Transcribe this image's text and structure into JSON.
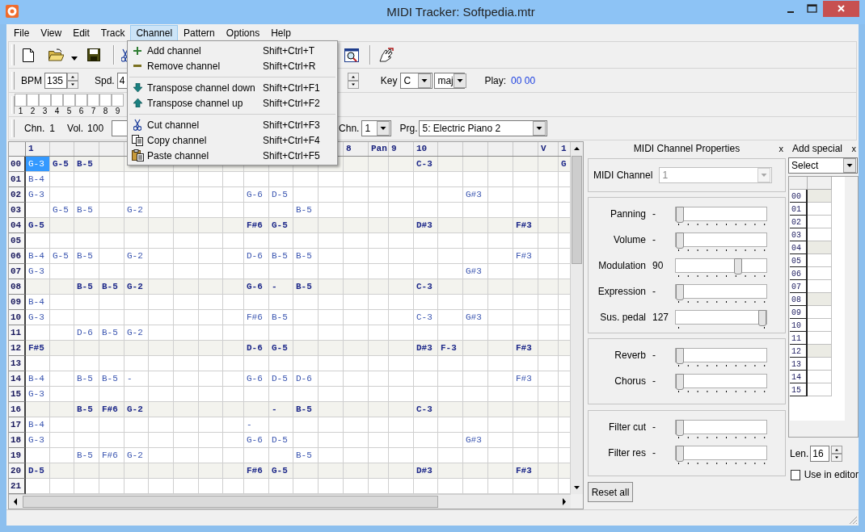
{
  "window": {
    "title": "MIDI Tracker: Softpedia.mtr"
  },
  "menu_bar": [
    {
      "label": "File",
      "selected": false
    },
    {
      "label": "View",
      "selected": false
    },
    {
      "label": "Edit",
      "selected": false
    },
    {
      "label": "Track",
      "selected": false
    },
    {
      "label": "Channel",
      "selected": true
    },
    {
      "label": "Pattern",
      "selected": false
    },
    {
      "label": "Options",
      "selected": false
    },
    {
      "label": "Help",
      "selected": false
    }
  ],
  "channel_menu": [
    {
      "kind": "item",
      "label": "Add channel",
      "shortcut": "Shift+Ctrl+T"
    },
    {
      "kind": "item",
      "label": "Remove channel",
      "shortcut": "Shift+Ctrl+R"
    },
    {
      "kind": "separator"
    },
    {
      "kind": "item",
      "label": "Transpose channel down",
      "shortcut": "Shift+Ctrl+F1"
    },
    {
      "kind": "item",
      "label": "Transpose channel up",
      "shortcut": "Shift+Ctrl+F2"
    },
    {
      "kind": "separator"
    },
    {
      "kind": "item",
      "label": "Cut channel",
      "shortcut": "Shift+Ctrl+F3"
    },
    {
      "kind": "item",
      "label": "Copy channel",
      "shortcut": "Shift+Ctrl+F4"
    },
    {
      "kind": "item",
      "label": "Paste channel",
      "shortcut": "Shift+Ctrl+F5"
    }
  ],
  "tempo_bar": {
    "bpm_label": "BPM",
    "bpm": "135",
    "speed_label": "Spd.",
    "speed": "4",
    "key_label": "Key",
    "key": "C",
    "scale": "maj",
    "play_label": "Play:",
    "play_position": "00 00"
  },
  "mute_bar": [
    {
      "label": "1",
      "checked": false
    },
    {
      "label": "2",
      "checked": false
    },
    {
      "label": "3",
      "checked": false
    },
    {
      "label": "4",
      "checked": false
    },
    {
      "label": "5",
      "checked": false
    },
    {
      "label": "6",
      "checked": false
    },
    {
      "label": "7",
      "checked": false
    },
    {
      "label": "8",
      "checked": false
    },
    {
      "label": "9",
      "checked": false
    }
  ],
  "channel_bar": {
    "channel_label": "Chn.",
    "channel": "1",
    "volume_label": "Vol.",
    "volume": "100",
    "midi_channel_label": "Chn.",
    "midi_channel": "1",
    "program_label": "Prg.",
    "program": "5: Electric Piano 2"
  },
  "pattern": {
    "headers": {
      "col_0": "1",
      "col_13": "8",
      "col_14": "Pan",
      "col_15": "9",
      "col_16": "10",
      "col_21": "V",
      "col_22": "1"
    },
    "rows": [
      {
        "label": "00",
        "accent": true,
        "cells": {
          "col_0": {
            "text": "G-3",
            "selected": true
          },
          "col_1": {
            "text": "G-5",
            "selected": false
          },
          "col_2": {
            "text": "B-5",
            "selected": false
          },
          "col_16": {
            "text": "C-3",
            "selected": false
          },
          "col_22": {
            "text": "G",
            "selected": false
          }
        }
      },
      {
        "label": "01",
        "accent": false,
        "cells": {
          "col_0": {
            "text": "B-4",
            "selected": false
          }
        }
      },
      {
        "label": "02",
        "accent": false,
        "cells": {
          "col_0": {
            "text": "G-3",
            "selected": false
          },
          "col_9": {
            "text": "G-6",
            "selected": false
          },
          "col_10": {
            "text": "D-5",
            "selected": false
          },
          "col_18": {
            "text": "G#3",
            "selected": false
          }
        }
      },
      {
        "label": "03",
        "accent": false,
        "cells": {
          "col_1": {
            "text": "G-5",
            "selected": false
          },
          "col_2": {
            "text": "B-5",
            "selected": false
          },
          "col_4": {
            "text": "G-2",
            "selected": false
          },
          "col_11": {
            "text": "B-5",
            "selected": false
          }
        }
      },
      {
        "label": "04",
        "accent": true,
        "cells": {
          "col_0": {
            "text": "G-5",
            "selected": false
          },
          "col_9": {
            "text": "F#6",
            "selected": false
          },
          "col_10": {
            "text": "G-5",
            "selected": false
          },
          "col_16": {
            "text": "D#3",
            "selected": false
          },
          "col_20": {
            "text": "F#3",
            "selected": false
          }
        }
      },
      {
        "label": "05",
        "accent": false
      },
      {
        "label": "06",
        "accent": false,
        "cells": {
          "col_0": {
            "text": "B-4",
            "selected": false
          },
          "col_1": {
            "text": "G-5",
            "selected": false
          },
          "col_2": {
            "text": "B-5",
            "selected": false
          },
          "col_4": {
            "text": "G-2",
            "selected": false
          },
          "col_9": {
            "text": "D-6",
            "selected": false
          },
          "col_10": {
            "text": "B-5",
            "selected": false
          },
          "col_11": {
            "text": "B-5",
            "selected": false
          },
          "col_20": {
            "text": "F#3",
            "selected": false
          }
        }
      },
      {
        "label": "07",
        "accent": false,
        "cells": {
          "col_0": {
            "text": "G-3",
            "selected": false
          },
          "col_18": {
            "text": "G#3",
            "selected": false
          }
        }
      },
      {
        "label": "08",
        "accent": true,
        "cells": {
          "col_2": {
            "text": "B-5",
            "selected": false
          },
          "col_3": {
            "text": "B-5",
            "selected": false
          },
          "col_4": {
            "text": "G-2",
            "selected": false
          },
          "col_9": {
            "text": "G-6",
            "selected": false
          },
          "col_10": {
            "text": "-",
            "selected": false
          },
          "col_11": {
            "text": "B-5",
            "selected": false
          },
          "col_16": {
            "text": "C-3",
            "selected": false
          }
        }
      },
      {
        "label": "09",
        "accent": false,
        "cells": {
          "col_0": {
            "text": "B-4",
            "selected": false
          }
        }
      },
      {
        "label": "10",
        "accent": false,
        "cells": {
          "col_0": {
            "text": "G-3",
            "selected": false
          },
          "col_9": {
            "text": "F#6",
            "selected": false
          },
          "col_10": {
            "text": "B-5",
            "selected": false
          },
          "col_16": {
            "text": "C-3",
            "selected": false
          },
          "col_18": {
            "text": "G#3",
            "selected": false
          }
        }
      },
      {
        "label": "11",
        "accent": false,
        "cells": {
          "col_2": {
            "text": "D-6",
            "selected": false
          },
          "col_3": {
            "text": "B-5",
            "selected": false
          },
          "col_4": {
            "text": "G-2",
            "selected": false
          }
        }
      },
      {
        "label": "12",
        "accent": true,
        "cells": {
          "col_0": {
            "text": "F#5",
            "selected": false
          },
          "col_9": {
            "text": "D-6",
            "selected": false
          },
          "col_10": {
            "text": "G-5",
            "selected": false
          },
          "col_16": {
            "text": "D#3",
            "selected": false
          },
          "col_17": {
            "text": "F-3",
            "selected": false
          },
          "col_20": {
            "text": "F#3",
            "selected": false
          }
        }
      },
      {
        "label": "13",
        "accent": false
      },
      {
        "label": "14",
        "accent": false,
        "cells": {
          "col_0": {
            "text": "B-4",
            "selected": false
          },
          "col_2": {
            "text": "B-5",
            "selected": false
          },
          "col_3": {
            "text": "B-5",
            "selected": false
          },
          "col_4": {
            "text": "-",
            "selected": false
          },
          "col_9": {
            "text": "G-6",
            "selected": false
          },
          "col_10": {
            "text": "D-5",
            "selected": false
          },
          "col_11": {
            "text": "D-6",
            "selected": false
          },
          "col_20": {
            "text": "F#3",
            "selected": false
          }
        }
      },
      {
        "label": "15",
        "accent": false,
        "cells": {
          "col_0": {
            "text": "G-3",
            "selected": false
          }
        }
      },
      {
        "label": "16",
        "accent": true,
        "cells": {
          "col_2": {
            "text": "B-5",
            "selected": false
          },
          "col_3": {
            "text": "F#6",
            "selected": false
          },
          "col_4": {
            "text": "G-2",
            "selected": false
          },
          "col_10": {
            "text": "-",
            "selected": false
          },
          "col_11": {
            "text": "B-5",
            "selected": false
          },
          "col_16": {
            "text": "C-3",
            "selected": false
          }
        }
      },
      {
        "label": "17",
        "accent": false,
        "cells": {
          "col_0": {
            "text": "B-4",
            "selected": false
          },
          "col_9": {
            "text": "-",
            "selected": false
          }
        }
      },
      {
        "label": "18",
        "accent": false,
        "cells": {
          "col_0": {
            "text": "G-3",
            "selected": false
          },
          "col_9": {
            "text": "G-6",
            "selected": false
          },
          "col_10": {
            "text": "D-5",
            "selected": false
          },
          "col_18": {
            "text": "G#3",
            "selected": false
          }
        }
      },
      {
        "label": "19",
        "accent": false,
        "cells": {
          "col_2": {
            "text": "B-5",
            "selected": false
          },
          "col_3": {
            "text": "F#6",
            "selected": false
          },
          "col_4": {
            "text": "G-2",
            "selected": false
          },
          "col_11": {
            "text": "B-5",
            "selected": false
          }
        }
      },
      {
        "label": "20",
        "accent": true,
        "cells": {
          "col_0": {
            "text": "D-5",
            "selected": false
          },
          "col_9": {
            "text": "F#6",
            "selected": false
          },
          "col_10": {
            "text": "G-5",
            "selected": false
          },
          "col_16": {
            "text": "D#3",
            "selected": false
          },
          "col_20": {
            "text": "F#3",
            "selected": false
          }
        }
      },
      {
        "label": "21",
        "accent": false
      }
    ]
  },
  "channel_properties": {
    "title": "MIDI Channel Properties",
    "close": "x",
    "midi_channel_label": "MIDI Channel",
    "midi_channel": "1",
    "midi_channel_disabled": true,
    "groups": [
      {
        "sliders": [
          {
            "label": "Panning",
            "reading": "-",
            "level": 0,
            "kind": "range"
          },
          {
            "label": "Volume",
            "reading": "-",
            "level": 0,
            "kind": "range"
          },
          {
            "label": "Modulation",
            "reading": "90",
            "level": 0.71,
            "kind": "range"
          },
          {
            "label": "Expression",
            "reading": "-",
            "level": 0,
            "kind": "range"
          },
          {
            "label": "Sus. pedal",
            "reading": "127",
            "level": 1,
            "kind": "switch"
          }
        ]
      },
      {
        "sliders": [
          {
            "label": "Reverb",
            "reading": "-",
            "level": 0,
            "kind": "range"
          },
          {
            "label": "Chorus",
            "reading": "-",
            "level": 0,
            "kind": "range"
          }
        ]
      },
      {
        "sliders": [
          {
            "label": "Filter cut",
            "reading": "-",
            "level": 0,
            "kind": "range"
          },
          {
            "label": "Filter res",
            "reading": "-",
            "level": 0,
            "kind": "range"
          }
        ]
      }
    ],
    "reset_button": "Reset all"
  },
  "add_special": {
    "title": "Add special",
    "close": "x",
    "select": "Select",
    "rows": [
      {
        "label": "00",
        "accent": true
      },
      {
        "label": "01",
        "accent": false
      },
      {
        "label": "02",
        "accent": false
      },
      {
        "label": "03",
        "accent": false
      },
      {
        "label": "04",
        "accent": true
      },
      {
        "label": "05",
        "accent": false
      },
      {
        "label": "06",
        "accent": false
      },
      {
        "label": "07",
        "accent": false
      },
      {
        "label": "08",
        "accent": true
      },
      {
        "label": "09",
        "accent": false
      },
      {
        "label": "10",
        "accent": false
      },
      {
        "label": "11",
        "accent": false
      },
      {
        "label": "12",
        "accent": true
      },
      {
        "label": "13",
        "accent": false
      },
      {
        "label": "14",
        "accent": false
      },
      {
        "label": "15",
        "accent": false
      }
    ],
    "length_label": "Len.",
    "length": "16",
    "use_in_editor": {
      "label": "Use in editor",
      "checked": false
    }
  }
}
